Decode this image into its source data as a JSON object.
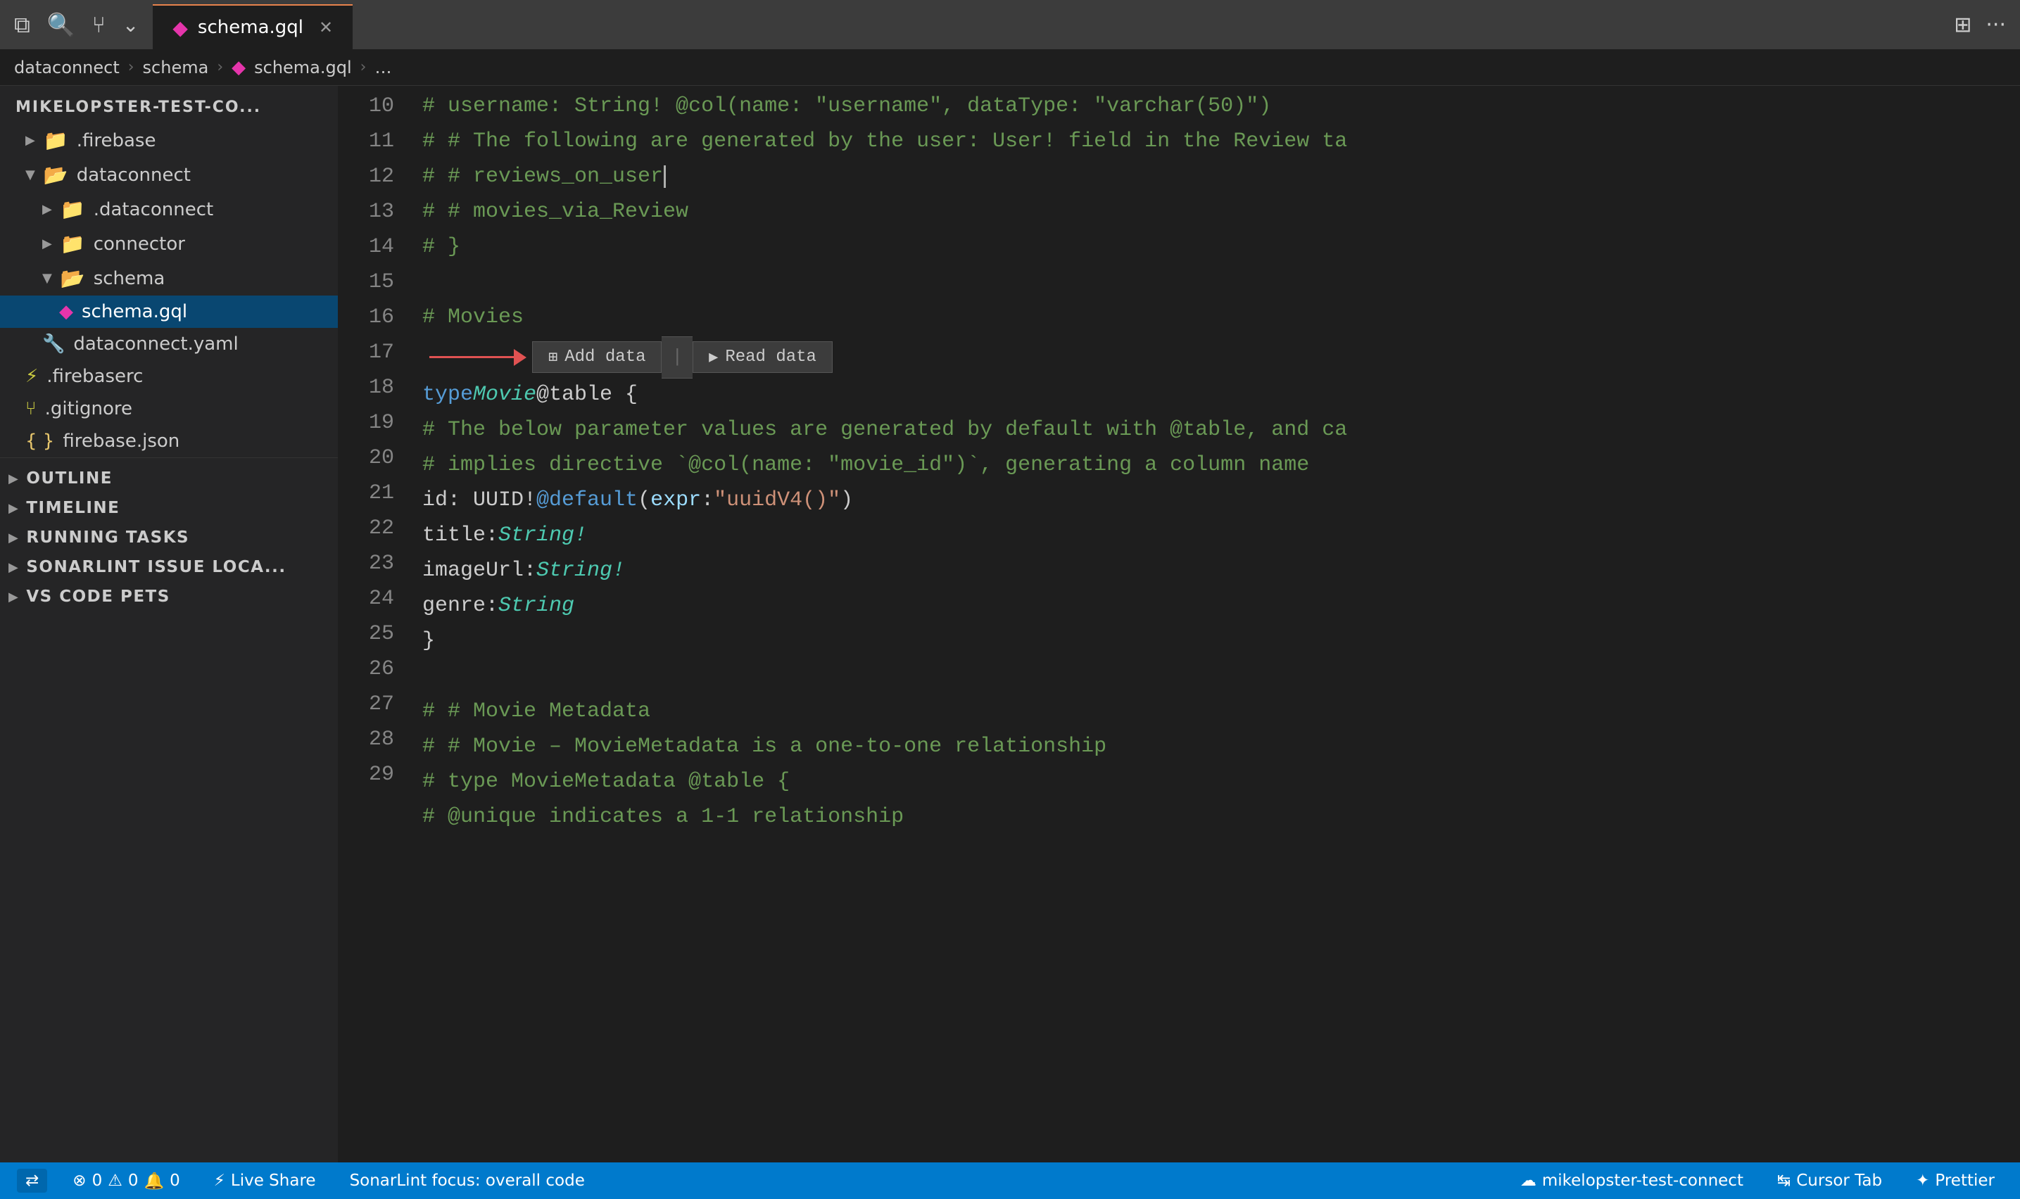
{
  "titleBar": {
    "icons": [
      "files-icon",
      "search-icon",
      "source-control-icon",
      "more-icon"
    ]
  },
  "tabs": [
    {
      "id": "schema-gql",
      "label": "schema.gql",
      "active": true,
      "icon": "graphql-icon"
    }
  ],
  "breadcrumb": {
    "parts": [
      "dataconnect",
      "schema",
      "schema.gql",
      "…"
    ]
  },
  "sidebar": {
    "rootLabel": "MIKELOPSTER-TEST-CO...",
    "items": [
      {
        "id": "firebase",
        "label": ".firebase",
        "type": "folder",
        "indent": 1,
        "collapsed": true
      },
      {
        "id": "dataconnect",
        "label": "dataconnect",
        "type": "folder",
        "indent": 1,
        "collapsed": false
      },
      {
        "id": "dataconnect-sub",
        "label": ".dataconnect",
        "type": "folder",
        "indent": 2,
        "collapsed": true
      },
      {
        "id": "connector",
        "label": "connector",
        "type": "folder",
        "indent": 2,
        "collapsed": true
      },
      {
        "id": "schema",
        "label": "schema",
        "type": "folder",
        "indent": 2,
        "collapsed": false
      },
      {
        "id": "schema-gql",
        "label": "schema.gql",
        "type": "file-gql",
        "indent": 3,
        "selected": true
      },
      {
        "id": "dataconnect-yaml",
        "label": "dataconnect.yaml",
        "type": "file-yaml",
        "indent": 2,
        "selected": false
      },
      {
        "id": "firebaserc",
        "label": ".firebaserc",
        "type": "file-js",
        "indent": 1,
        "selected": false
      },
      {
        "id": "gitignore",
        "label": ".gitignore",
        "type": "file-text",
        "indent": 1,
        "selected": false
      },
      {
        "id": "firebase-json",
        "label": "firebase.json",
        "type": "file-json",
        "indent": 1,
        "selected": false
      }
    ],
    "bottomGroups": [
      {
        "id": "outline",
        "label": "OUTLINE",
        "collapsed": true
      },
      {
        "id": "timeline",
        "label": "TIMELINE",
        "collapsed": true
      },
      {
        "id": "running-tasks",
        "label": "RUNNING TASKS",
        "collapsed": true
      },
      {
        "id": "sonarlint",
        "label": "SONARLINT ISSUE LOCA...",
        "collapsed": true
      },
      {
        "id": "vscode-pets",
        "label": "VS CODE PETS",
        "collapsed": true
      }
    ]
  },
  "editor": {
    "filename": "schema.gql",
    "lines": [
      {
        "num": 10,
        "content": [
          {
            "t": "#   username: String! @col(name: \"username\", dataType: \"varchar(50)\")",
            "c": "c-comment"
          }
        ]
      },
      {
        "num": 11,
        "content": [
          {
            "t": "#   # The following are generated by the user: User! field in the Review ta",
            "c": "c-comment"
          }
        ]
      },
      {
        "num": 12,
        "content": [
          {
            "t": "#   # reviews_on_user",
            "c": "c-comment"
          }
        ],
        "cursor": true
      },
      {
        "num": 13,
        "content": [
          {
            "t": "#   # movies_via_Review",
            "c": "c-comment"
          }
        ]
      },
      {
        "num": 14,
        "content": [
          {
            "t": "# }",
            "c": "c-comment"
          }
        ]
      },
      {
        "num": 15,
        "content": []
      },
      {
        "num": 16,
        "content": [
          {
            "t": "# Movies",
            "c": "c-comment"
          }
        ],
        "codelens": true
      },
      {
        "num": 17,
        "content": [
          {
            "t": "type ",
            "c": "c-keyword"
          },
          {
            "t": "Movie",
            "c": "c-type"
          },
          {
            "t": " @table {",
            "c": "c-punct"
          }
        ]
      },
      {
        "num": 18,
        "content": [
          {
            "t": "    # The below parameter values are generated by default with @table, and ca",
            "c": "c-comment"
          }
        ]
      },
      {
        "num": 19,
        "content": [
          {
            "t": "    # implies directive `@col(name: \"movie_id\")`, generating a column name",
            "c": "c-comment"
          }
        ]
      },
      {
        "num": 20,
        "content": [
          {
            "t": "    id: UUID! ",
            "c": "c-punct"
          },
          {
            "t": "@default",
            "c": "c-directive"
          },
          {
            "t": "(",
            "c": "c-punct"
          },
          {
            "t": "expr",
            "c": "c-param"
          },
          {
            "t": ": ",
            "c": "c-punct"
          },
          {
            "t": "\"uuidV4()\"",
            "c": "c-value"
          },
          {
            "t": ")",
            "c": "c-punct"
          }
        ]
      },
      {
        "num": 21,
        "content": [
          {
            "t": "    title: ",
            "c": "c-punct"
          },
          {
            "t": "String!",
            "c": "c-type"
          }
        ]
      },
      {
        "num": 22,
        "content": [
          {
            "t": "    imageUrl: ",
            "c": "c-punct"
          },
          {
            "t": "String!",
            "c": "c-type"
          }
        ]
      },
      {
        "num": 23,
        "content": [
          {
            "t": "    genre: ",
            "c": "c-punct"
          },
          {
            "t": "String",
            "c": "c-type"
          }
        ]
      },
      {
        "num": 24,
        "content": [
          {
            "t": "}",
            "c": "c-punct"
          }
        ]
      },
      {
        "num": 25,
        "content": []
      },
      {
        "num": 26,
        "content": [
          {
            "t": "# # Movie Metadata",
            "c": "c-comment"
          }
        ]
      },
      {
        "num": 27,
        "content": [
          {
            "t": "# # Movie - MovieMetadata is a one-to-one relationship",
            "c": "c-comment"
          }
        ]
      },
      {
        "num": 28,
        "content": [
          {
            "t": "# type MovieMetadata @table {",
            "c": "c-comment"
          }
        ]
      },
      {
        "num": 29,
        "content": [
          {
            "t": "# @unique indicates a 1-1 relationship",
            "c": "c-comment"
          }
        ]
      }
    ],
    "codelens": {
      "addData": "Add data",
      "readData": "Read data",
      "separator": "|"
    }
  },
  "statusBar": {
    "left": [
      {
        "id": "remote",
        "icon": "remote-icon",
        "label": "mikelopster-test-connect"
      },
      {
        "id": "errors",
        "icon": "error-icon",
        "label": "0"
      },
      {
        "id": "warnings",
        "icon": "warning-icon",
        "label": "0"
      },
      {
        "id": "info",
        "icon": "info-icon",
        "label": "0"
      }
    ],
    "center": [
      {
        "id": "live-share",
        "icon": "live-share-icon",
        "label": "Live Share"
      }
    ],
    "middle": [
      {
        "id": "sonarlint-focus",
        "label": "SonarLint focus: overall code"
      }
    ],
    "right": [
      {
        "id": "remote-right",
        "icon": "remote-icon-right",
        "label": "mikelopster-test-connect"
      },
      {
        "id": "cursor-tab",
        "icon": "cursor-tab-icon",
        "label": "Cursor Tab"
      },
      {
        "id": "prettier",
        "icon": "prettier-icon",
        "label": "Prettier"
      }
    ]
  }
}
